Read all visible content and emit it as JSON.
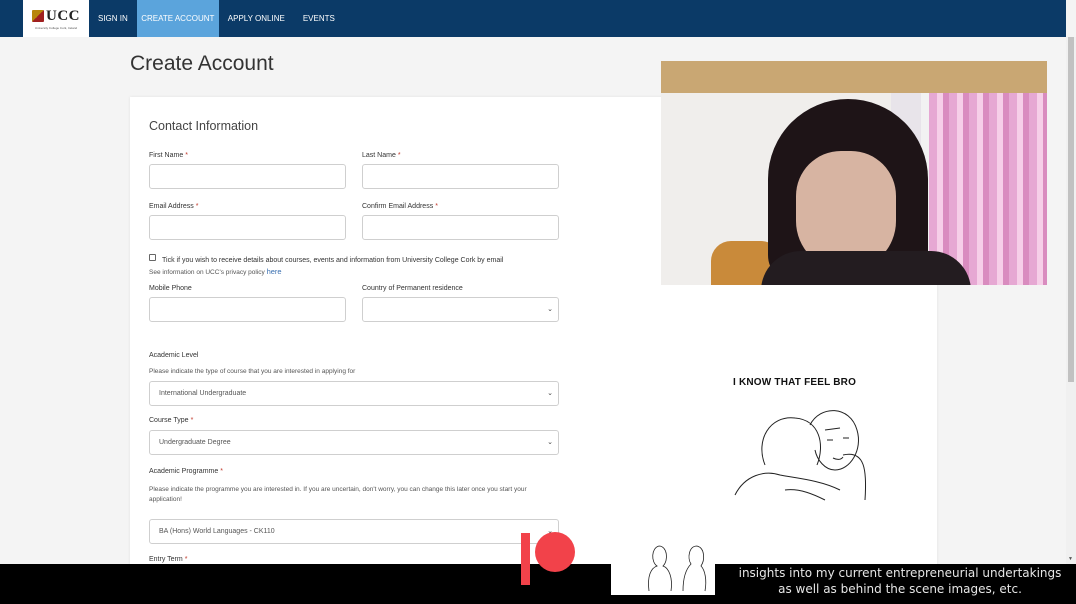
{
  "nav": {
    "logo_text": "UCC",
    "logo_subtitle": "University College Cork, Ireland",
    "items": [
      {
        "label": "Sign In",
        "active": false
      },
      {
        "label": "Create Account",
        "active": true
      },
      {
        "label": "Apply Online",
        "active": false
      },
      {
        "label": "Events",
        "active": false
      }
    ]
  },
  "page": {
    "title": "Create Account"
  },
  "form": {
    "section_title": "Contact Information",
    "required_marker": "*",
    "first_name": {
      "label": "First Name",
      "value": ""
    },
    "last_name": {
      "label": "Last Name",
      "value": ""
    },
    "email": {
      "label": "Email Address",
      "value": ""
    },
    "confirm_email": {
      "label": "Confirm Email Address",
      "value": ""
    },
    "opt_in": {
      "label": "Tick if you wish to receive details about courses, events and information from University College Cork by email",
      "checked": false,
      "privacy_text": "See information on UCC's privacy policy",
      "privacy_link": "here"
    },
    "mobile_phone": {
      "label": "Mobile Phone",
      "value": ""
    },
    "country": {
      "label": "Country of Permanent residence",
      "value": ""
    },
    "academic_level": {
      "label": "Academic Level",
      "help": "Please indicate the type of course that you are interested in applying for",
      "value": "International Undergraduate"
    },
    "course_type": {
      "label": "Course Type",
      "value": "Undergraduate Degree"
    },
    "academic_programme": {
      "label": "Academic Programme",
      "help": "Please indicate the programme you are interested in. If you are uncertain, don't worry, you can change this later once you start your application!",
      "value": "BA (Hons) World Languages - CK110"
    },
    "entry_term": {
      "label": "Entry Term"
    }
  },
  "overlay": {
    "meme_caption": "I KNOW THAT FEEL BRO",
    "subtitle_line1": "insights into my current entrepreneurial undertakings",
    "subtitle_line2": "as well as behind the scene images, etc.",
    "patreon_color": "#f2424a"
  },
  "colors": {
    "nav_bg": "#0b3a67",
    "nav_active": "#5ba4dc",
    "required": "#c0392b",
    "link": "#3a6fb0"
  }
}
